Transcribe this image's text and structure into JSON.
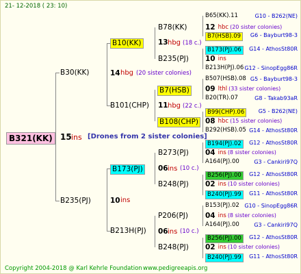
{
  "header": "21- 12-2018 ( 23: 10)",
  "root": {
    "label": "B321(KK)",
    "num": "15",
    "ins": "ins",
    "drones": "[Drones from 2 sister colonies]"
  },
  "g1": [
    {
      "label": "B30(KK)",
      "num": "14",
      "hbg": "hbg",
      "sis": "(20 sister colonies)"
    },
    {
      "label": "B235(PJ)",
      "num": "10",
      "ins": "ins"
    }
  ],
  "g2": [
    {
      "label": "B10(KK)",
      "num": "13",
      "hbg": "hbg",
      "sis": "(18 c.)"
    },
    {
      "label": "B101(CHP)",
      "num": "11",
      "hbg": "hbg",
      "sis": "(22 c.)"
    },
    {
      "label": "B173(PJ)",
      "num": "06",
      "ins": "ins",
      "sis": "(10 c.)"
    },
    {
      "label": "B213H(PJ)",
      "num": "06",
      "ins": "ins",
      "sis": "(10 c.)"
    }
  ],
  "g3": [
    {
      "label": "B78(KK)"
    },
    {
      "label": "B235(PJ)"
    },
    {
      "label": "B7(HSB)",
      "num": "09",
      "ins": "lthl",
      "sis": "(33 sister colonies)"
    },
    {
      "label": "B108(CHP)",
      "num": "08",
      "ins": "hbc",
      "sis": "(15 sister colonies)"
    },
    {
      "label": "B273(PJ)",
      "num": "04",
      "ins": "ins",
      "sis": "(8 sister colonies)"
    },
    {
      "label": "B248(PJ)",
      "num": "02",
      "ins": "ins",
      "sis": "(10 sister colonies)"
    },
    {
      "label": "P206(PJ)",
      "num": "04",
      "ins": "ins",
      "sis": "(8 sister colonies)"
    },
    {
      "label": "B248(PJ)",
      "num": "02",
      "ins": "ins",
      "sis": "(10 sister colonies)"
    }
  ],
  "g4": [
    {
      "label": "B65(KK).11",
      "src": "G10 - B262(NE)"
    },
    {
      "label": "12",
      "ins": "hbc",
      "sis": "(20 sister colonies)"
    },
    {
      "label": "B7(HSB).09",
      "src": "G6 - Bayburt98-3"
    },
    {
      "label": "B173(PJ).06",
      "src": "G14 - AthosSt80R"
    },
    {
      "label": "10",
      "ins": "ins"
    },
    {
      "label": "B213H(PJ).06",
      "src": "G12 - SinopEgg86R"
    },
    {
      "label": "B507(HSB).08",
      "src": "G5 - Bayburt98-3"
    },
    {
      "label": "09",
      "ins": "lthl",
      "sis": "(33 sister colonies)"
    },
    {
      "label": "B20(TR).07",
      "src": "G8 - Takab93aR"
    },
    {
      "label": "B99(CHP).06",
      "src": "G5 - B262(NE)"
    },
    {
      "label": "08",
      "ins": "hbc",
      "sis": "(15 sister colonies)"
    },
    {
      "label": "B292(HSB).05",
      "src": "G14 - AthosSt80R"
    },
    {
      "label": "B194(PJ).02",
      "src": "G12 - AthosSt80R"
    },
    {
      "label": "04",
      "ins": "ins",
      "sis": "(8 sister colonies)"
    },
    {
      "label": "A164(PJ).00",
      "src": "G3 - Cankiri97Q"
    },
    {
      "label": "B256(PJ).00",
      "src": "G12 - AthosSt80R"
    },
    {
      "label": "02",
      "ins": "ins",
      "sis": "(10 sister colonies)"
    },
    {
      "label": "B240(PJ).99",
      "src": "G11 - AthosSt80R"
    },
    {
      "label": "B153(PJ).02",
      "src": "G10 - SinopEgg86R"
    },
    {
      "label": "04",
      "ins": "ins",
      "sis": "(8 sister colonies)"
    },
    {
      "label": "A164(PJ).00",
      "src": "G3 - Cankiri97Q"
    },
    {
      "label": "B256(PJ).00",
      "src": "G12 - AthosSt80R"
    },
    {
      "label": "02",
      "ins": "ins",
      "sis": "(10 sister colonies)"
    },
    {
      "label": "B240(PJ).99",
      "src": "G11 - AthosSt80R"
    }
  ],
  "footer": {
    "copyright": "Copyright 2004-2018 @ Karl Kehrle Foundation",
    "site": "www.pedigreeapis.org"
  }
}
